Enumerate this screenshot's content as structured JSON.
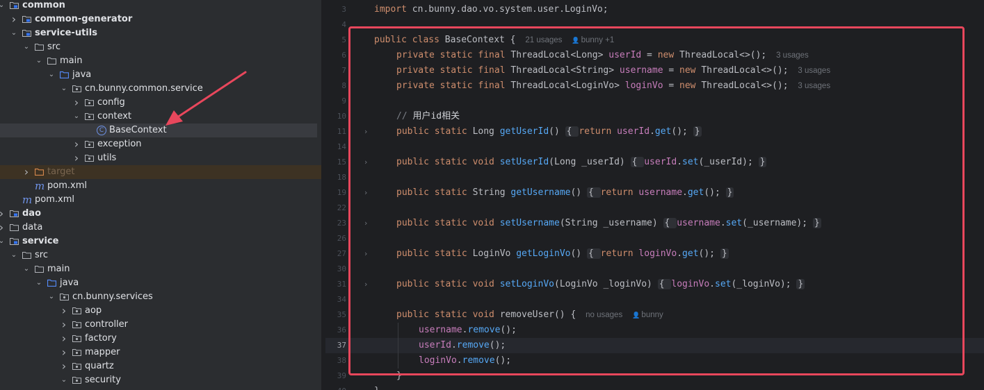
{
  "project_tree": [
    {
      "depth": 0,
      "label": "common",
      "bold": true,
      "expanded": true,
      "icon": "module-folder-icon",
      "arrow": true
    },
    {
      "depth": 1,
      "label": "common-generator",
      "bold": true,
      "expanded": false,
      "icon": "module-folder-icon"
    },
    {
      "depth": 1,
      "label": "service-utils",
      "bold": true,
      "expanded": true,
      "icon": "module-folder-icon"
    },
    {
      "depth": 2,
      "label": "src",
      "expanded": true,
      "icon": "folder-icon"
    },
    {
      "depth": 3,
      "label": "main",
      "expanded": true,
      "icon": "folder-icon"
    },
    {
      "depth": 4,
      "label": "java",
      "expanded": true,
      "icon": "source-folder-icon"
    },
    {
      "depth": 5,
      "label": "cn.bunny.common.service",
      "expanded": true,
      "icon": "package-icon"
    },
    {
      "depth": 6,
      "label": "config",
      "expanded": false,
      "icon": "package-icon"
    },
    {
      "depth": 6,
      "label": "context",
      "expanded": true,
      "icon": "package-icon"
    },
    {
      "depth": 7,
      "label": "BaseContext",
      "icon": "class-icon",
      "selected": true
    },
    {
      "depth": 6,
      "label": "exception",
      "expanded": false,
      "icon": "package-icon"
    },
    {
      "depth": 6,
      "label": "utils",
      "expanded": false,
      "icon": "package-icon"
    },
    {
      "depth": 2,
      "label": "target",
      "expanded": false,
      "icon": "excluded-folder-icon",
      "excluded": true
    },
    {
      "depth": 2,
      "label": "pom.xml",
      "icon": "maven-icon"
    },
    {
      "depth": 1,
      "label": "pom.xml",
      "icon": "maven-icon"
    },
    {
      "depth": 0,
      "label": "dao",
      "bold": true,
      "expanded": false,
      "icon": "module-folder-icon"
    },
    {
      "depth": 0,
      "label": "data",
      "expanded": false,
      "icon": "folder-icon"
    },
    {
      "depth": 0,
      "label": "service",
      "bold": true,
      "expanded": true,
      "icon": "module-folder-icon"
    },
    {
      "depth": 1,
      "label": "src",
      "expanded": true,
      "icon": "folder-icon"
    },
    {
      "depth": 2,
      "label": "main",
      "expanded": true,
      "icon": "folder-icon"
    },
    {
      "depth": 3,
      "label": "java",
      "expanded": true,
      "icon": "source-folder-icon"
    },
    {
      "depth": 4,
      "label": "cn.bunny.services",
      "expanded": true,
      "icon": "package-icon"
    },
    {
      "depth": 5,
      "label": "aop",
      "expanded": false,
      "icon": "package-icon"
    },
    {
      "depth": 5,
      "label": "controller",
      "expanded": false,
      "icon": "package-icon"
    },
    {
      "depth": 5,
      "label": "factory",
      "expanded": false,
      "icon": "package-icon"
    },
    {
      "depth": 5,
      "label": "mapper",
      "expanded": false,
      "icon": "package-icon"
    },
    {
      "depth": 5,
      "label": "quartz",
      "expanded": false,
      "icon": "package-icon"
    },
    {
      "depth": 5,
      "label": "security",
      "expanded": true,
      "icon": "package-icon"
    }
  ],
  "editor": {
    "current_line": "37",
    "lines": [
      {
        "n": "3",
        "indent": 0,
        "tokens": [
          [
            "kw",
            "import "
          ],
          [
            "ty",
            "cn.bunny.dao.vo.system.user.LoginVo;"
          ]
        ]
      },
      {
        "n": "4",
        "indent": 0,
        "tokens": []
      },
      {
        "n": "5",
        "indent": 0,
        "tokens": [
          [
            "kw",
            "public class "
          ],
          [
            "ty",
            "BaseContext { "
          ]
        ],
        "hint": "21 usages",
        "author": "bunny +1"
      },
      {
        "n": "6",
        "indent": 1,
        "tokens": [
          [
            "kw",
            "private static final "
          ],
          [
            "ty",
            "ThreadLocal<Long> "
          ],
          [
            "fld",
            "userId"
          ],
          [
            "ty",
            " = "
          ],
          [
            "kw",
            "new "
          ],
          [
            "ty",
            "ThreadLocal<>(); "
          ]
        ],
        "hint": "3 usages"
      },
      {
        "n": "7",
        "indent": 1,
        "tokens": [
          [
            "kw",
            "private static final "
          ],
          [
            "ty",
            "ThreadLocal<String> "
          ],
          [
            "fld",
            "username"
          ],
          [
            "ty",
            " = "
          ],
          [
            "kw",
            "new "
          ],
          [
            "ty",
            "ThreadLocal<>(); "
          ]
        ],
        "hint": "3 usages"
      },
      {
        "n": "8",
        "indent": 1,
        "tokens": [
          [
            "kw",
            "private static final "
          ],
          [
            "ty",
            "ThreadLocal<LoginVo> "
          ],
          [
            "fld",
            "loginVo"
          ],
          [
            "ty",
            " = "
          ],
          [
            "kw",
            "new "
          ],
          [
            "ty",
            "ThreadLocal<>(); "
          ]
        ],
        "hint": "3 usages"
      },
      {
        "n": "9",
        "indent": 0,
        "tokens": []
      },
      {
        "n": "10",
        "indent": 1,
        "tokens": [
          [
            "cm",
            "// "
          ],
          [
            "cmz",
            "用户id相关"
          ]
        ]
      },
      {
        "n": "11",
        "indent": 1,
        "fold": true,
        "tokens": [
          [
            "kw",
            "public static "
          ],
          [
            "ty",
            "Long "
          ],
          [
            "fn",
            "getUserId"
          ],
          [
            "ty",
            "() "
          ],
          [
            "box",
            "{ "
          ],
          [
            "kw",
            "return "
          ],
          [
            "fld",
            "userId"
          ],
          [
            "ty",
            "."
          ],
          [
            "fn",
            "get"
          ],
          [
            "ty",
            "(); "
          ],
          [
            "box",
            "}"
          ]
        ]
      },
      {
        "n": "14",
        "indent": 0,
        "tokens": []
      },
      {
        "n": "15",
        "indent": 1,
        "fold": true,
        "tokens": [
          [
            "kw",
            "public static void "
          ],
          [
            "fn",
            "setUserId"
          ],
          [
            "ty",
            "(Long _userId) "
          ],
          [
            "box",
            "{ "
          ],
          [
            "fld",
            "userId"
          ],
          [
            "ty",
            "."
          ],
          [
            "fn",
            "set"
          ],
          [
            "ty",
            "(_userId); "
          ],
          [
            "box",
            "}"
          ]
        ]
      },
      {
        "n": "18",
        "indent": 0,
        "tokens": []
      },
      {
        "n": "19",
        "indent": 1,
        "fold": true,
        "tokens": [
          [
            "kw",
            "public static "
          ],
          [
            "ty",
            "String "
          ],
          [
            "fn",
            "getUsername"
          ],
          [
            "ty",
            "() "
          ],
          [
            "box",
            "{ "
          ],
          [
            "kw",
            "return "
          ],
          [
            "fld",
            "username"
          ],
          [
            "ty",
            "."
          ],
          [
            "fn",
            "get"
          ],
          [
            "ty",
            "(); "
          ],
          [
            "box",
            "}"
          ]
        ]
      },
      {
        "n": "22",
        "indent": 0,
        "tokens": []
      },
      {
        "n": "23",
        "indent": 1,
        "fold": true,
        "tokens": [
          [
            "kw",
            "public static void "
          ],
          [
            "fn",
            "setUsername"
          ],
          [
            "ty",
            "(String _username) "
          ],
          [
            "box",
            "{ "
          ],
          [
            "fld",
            "username"
          ],
          [
            "ty",
            "."
          ],
          [
            "fn",
            "set"
          ],
          [
            "ty",
            "(_username); "
          ],
          [
            "box",
            "}"
          ]
        ]
      },
      {
        "n": "26",
        "indent": 0,
        "tokens": []
      },
      {
        "n": "27",
        "indent": 1,
        "fold": true,
        "tokens": [
          [
            "kw",
            "public static "
          ],
          [
            "ty",
            "LoginVo "
          ],
          [
            "fn",
            "getLoginVo"
          ],
          [
            "ty",
            "() "
          ],
          [
            "box",
            "{ "
          ],
          [
            "kw",
            "return "
          ],
          [
            "fld",
            "loginVo"
          ],
          [
            "ty",
            "."
          ],
          [
            "fn",
            "get"
          ],
          [
            "ty",
            "(); "
          ],
          [
            "box",
            "}"
          ]
        ]
      },
      {
        "n": "30",
        "indent": 0,
        "tokens": []
      },
      {
        "n": "31",
        "indent": 1,
        "fold": true,
        "tokens": [
          [
            "kw",
            "public static void "
          ],
          [
            "fn",
            "setLoginVo"
          ],
          [
            "ty",
            "(LoginVo _loginVo) "
          ],
          [
            "box",
            "{ "
          ],
          [
            "fld",
            "loginVo"
          ],
          [
            "ty",
            "."
          ],
          [
            "fn",
            "set"
          ],
          [
            "ty",
            "(_loginVo); "
          ],
          [
            "box",
            "}"
          ]
        ]
      },
      {
        "n": "34",
        "indent": 0,
        "tokens": []
      },
      {
        "n": "35",
        "indent": 1,
        "tokens": [
          [
            "kw",
            "public static void "
          ],
          [
            "ty",
            "removeUser() { "
          ]
        ],
        "hint": "no usages",
        "author": "bunny"
      },
      {
        "n": "36",
        "indent": 2,
        "tokens": [
          [
            "fld",
            "username"
          ],
          [
            "ty",
            "."
          ],
          [
            "fn",
            "remove"
          ],
          [
            "ty",
            "();"
          ]
        ]
      },
      {
        "n": "37",
        "indent": 2,
        "tokens": [
          [
            "fld",
            "userId"
          ],
          [
            "ty",
            "."
          ],
          [
            "fn",
            "remove"
          ],
          [
            "ty",
            "();"
          ]
        ]
      },
      {
        "n": "38",
        "indent": 2,
        "tokens": [
          [
            "fld",
            "loginVo"
          ],
          [
            "ty",
            "."
          ],
          [
            "fn",
            "remove"
          ],
          [
            "ty",
            "();"
          ]
        ]
      },
      {
        "n": "39",
        "indent": 1,
        "tokens": [
          [
            "ty",
            "}"
          ]
        ]
      },
      {
        "n": "40",
        "indent": 0,
        "tokens": [
          [
            "ty",
            "}"
          ]
        ]
      }
    ]
  },
  "colors": {
    "highlight_border": "#e8475c",
    "arrow": "#e8475c"
  }
}
